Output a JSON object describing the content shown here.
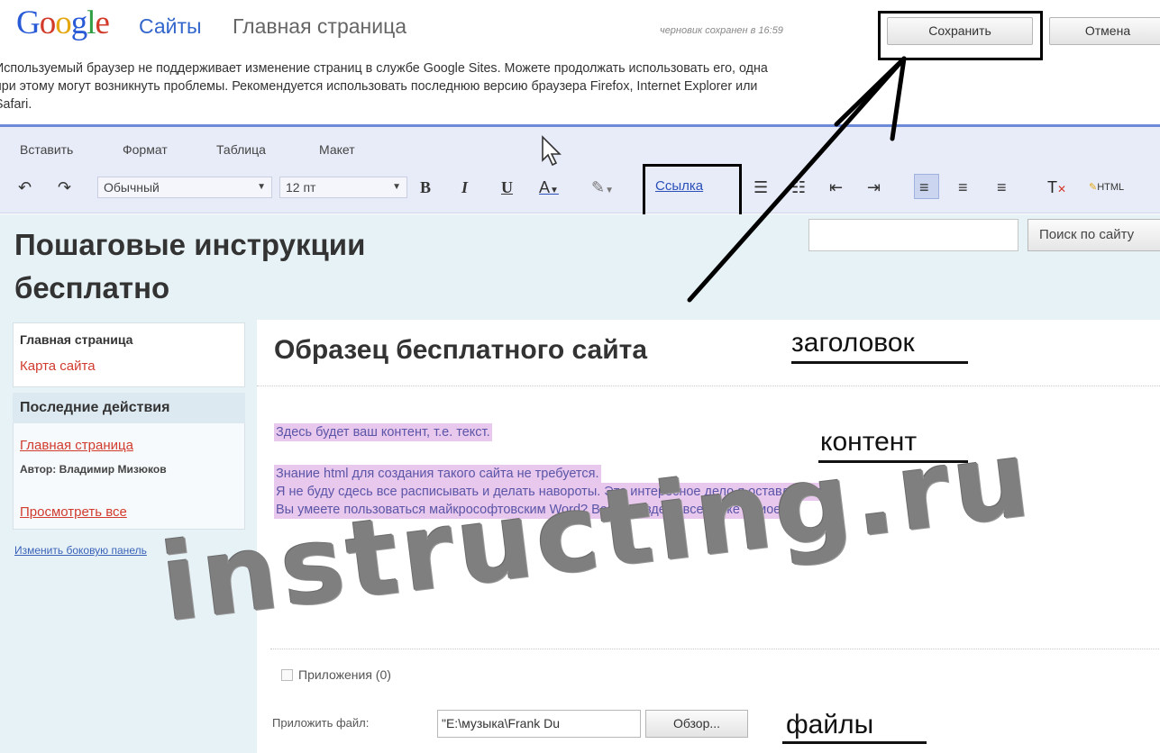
{
  "header": {
    "logo_parts": [
      "G",
      "o",
      "o",
      "g",
      "l",
      "e"
    ],
    "product": "Сайты",
    "page_title": "Главная страница",
    "draft_status": "черновик сохранен в 16:59",
    "save_label": "Сохранить",
    "cancel_label": "Отмена"
  },
  "warning": {
    "line1": "Используемый браузер не поддерживает изменение страниц в службе Google Sites. Можете продолжать использовать его, одна",
    "line2": "при этому могут возникнуть проблемы. Рекомендуется использовать последнюю версию браузера Firefox, Internet Explorer или",
    "line3": "Safari."
  },
  "menu": {
    "items": [
      "Вставить",
      "Формат",
      "Таблица",
      "Макет"
    ]
  },
  "toolbar": {
    "style_value": "Обычный",
    "size_value": "12 пт",
    "bold": "B",
    "italic": "I",
    "underline": "U",
    "text_color": "A",
    "link_label": "Ссылка",
    "html_label": "HTML"
  },
  "site": {
    "title": "Пошаговые инструкции бесплатно",
    "search_button": "Поиск по сайту"
  },
  "sidebar": {
    "nav_home": "Главная страница",
    "nav_sitemap": "Карта сайта",
    "recent_title": "Последние действия",
    "recent_link": "Главная страница",
    "recent_author": "Автор: Владимир Мизюков",
    "view_all": "Просмотреть все",
    "edit_sidebar": "Изменить боковую панель"
  },
  "content": {
    "title": "Образец бесплатного сайта",
    "line1": "Здесь будет ваш контент, т.е. текст.",
    "line2": "Знание html для создания такого сайта не требуется.",
    "line3": "Я не буду сдесь все расписывать и делать навороты. Это интересное дело я оставлю вам.",
    "line4": "Вы умеете пользоваться майкрософтовским Word? Вобщем здесь все то же самое :)",
    "attachments": "Приложения (0)",
    "attach_label": "Приложить файл:",
    "file_value": "\"E:\\музыка\\Frank Du",
    "browse": "Обзор..."
  },
  "annotations": {
    "heading": "заголовок",
    "content": "контент",
    "files": "файлы"
  },
  "watermark": "instructing.ru",
  "colors": {
    "brand_blue": "#3366cc",
    "link_red": "#d13b2e",
    "highlight": "#e8c8ec",
    "site_bg": "#e7f2f7"
  }
}
